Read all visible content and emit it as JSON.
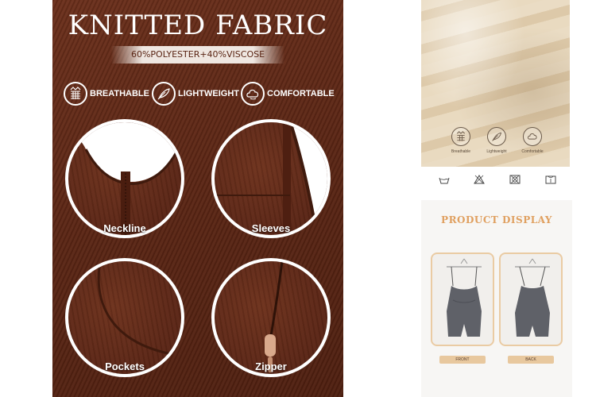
{
  "left": {
    "title": "KNITTED FABRIC",
    "composition": "60%POLYESTER+40%VISCOSE",
    "features": [
      {
        "label": "BREATHABLE",
        "icon": "breathable-icon"
      },
      {
        "label": "LIGHTWEIGHT",
        "icon": "feather-icon"
      },
      {
        "label": "COMFORTABLE",
        "icon": "cloud-icon"
      }
    ],
    "details": [
      {
        "label": "Neckline"
      },
      {
        "label": "Sleeves"
      },
      {
        "label": "Pockets"
      },
      {
        "label": "Zipper"
      }
    ],
    "colors": {
      "fabric": "#5a2514",
      "text": "#ffffff"
    }
  },
  "right_top": {
    "features": [
      {
        "label": "Breathable",
        "icon": "breathable-icon"
      },
      {
        "label": "Lightweight",
        "icon": "feather-icon"
      },
      {
        "label": "Comfortable",
        "icon": "cloud-icon"
      }
    ],
    "care": [
      {
        "label": "",
        "icon": "wash-icon"
      },
      {
        "label": "",
        "icon": "no-bleach-icon"
      },
      {
        "label": "",
        "icon": "no-tumble-dry-icon"
      },
      {
        "label": "",
        "icon": "hang-dry-icon"
      }
    ]
  },
  "right_bottom": {
    "title": "PRODUCT DISPLAY",
    "subtitle": "",
    "products": [
      {
        "tag": "FRONT"
      },
      {
        "tag": "BACK"
      }
    ],
    "colors": {
      "accent": "#e0a060",
      "garment": "#5f6168"
    }
  }
}
